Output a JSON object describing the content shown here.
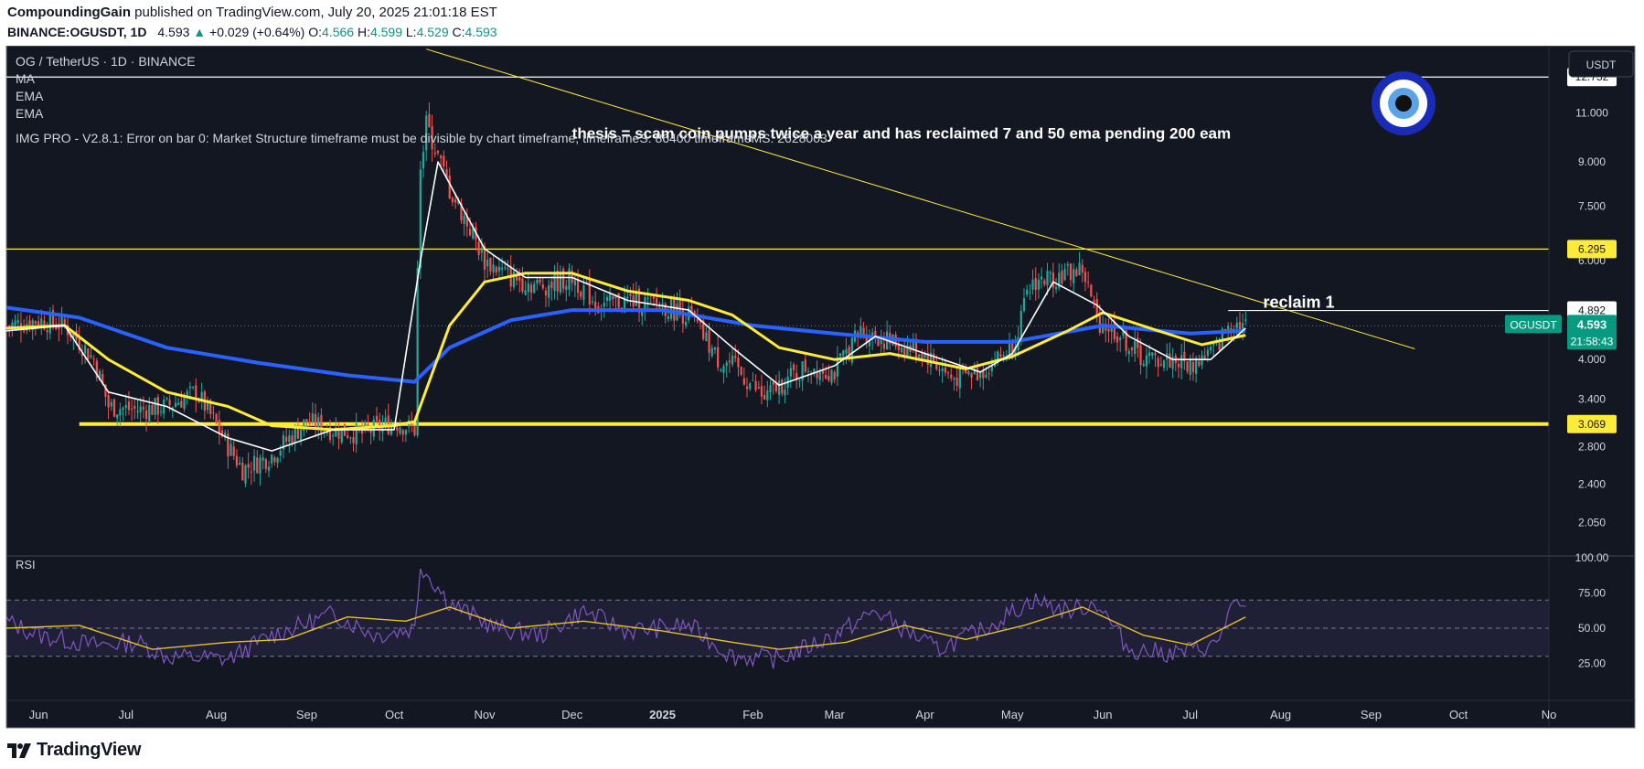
{
  "header": {
    "author": "CompoundingGain",
    "published_text": "published on TradingView.com, July 20, 2025 21:01:18 EST",
    "symbol": "BINANCE:OGUSDT, 1D",
    "last": "4.593",
    "change_arrow": "▲",
    "change": "+0.029 (+0.64%)",
    "o_label": "O:",
    "o": "4.566",
    "h_label": "H:",
    "h": "4.599",
    "l_label": "L:",
    "l": "4.529",
    "c_label": "C:",
    "c": "4.593"
  },
  "footer": {
    "brand": "TradingView"
  },
  "colors": {
    "background": "#131722",
    "candle_up": "#26a69a",
    "candle_down": "#ef5350",
    "ema_fast": "#ffffff",
    "ema_mid": "#ffeb3b",
    "ema_slow": "#2962ff",
    "support": "#ffeb3b",
    "rsi_line": "#7e57c2",
    "rsi_ma": "#e6c125",
    "last_price": "#089981"
  },
  "chart_data": {
    "type": "candlestick",
    "title": "OG / TetherUS · 1D · BINANCE",
    "currency_button": "USDT",
    "indicators": [
      "MA",
      "EMA",
      "EMA"
    ],
    "error_text": "IMG PRO - V2.8.1: Error on bar 0: Market Structure timeframe must be divisible by chart timeframe, timeframeS: 86400 timeframeMS: 2628003",
    "annotations": [
      {
        "text": "thesis = scam coin pumps twice a year and has reclaimed 7 and 50 ema pending 200 eam",
        "date": "2024-12-01",
        "price": 9.9
      },
      {
        "text": "reclaim 1",
        "date": "2025-07-26",
        "price": 4.95
      }
    ],
    "y_scale": "log",
    "y_range": [
      1.8,
      14.5
    ],
    "y_ticks": [
      "11.000",
      "9.000",
      "7.500",
      "6.000",
      "4.000",
      "3.400",
      "2.800",
      "2.400",
      "2.050"
    ],
    "y_tick_values": [
      11.0,
      9.0,
      7.5,
      6.0,
      4.0,
      3.4,
      2.8,
      2.4,
      2.05
    ],
    "x_range": [
      "2024-05-21",
      "2025-11-01"
    ],
    "x_ticks": [
      {
        "label": "Jun",
        "date": "2024-06-01"
      },
      {
        "label": "Jul",
        "date": "2024-07-01"
      },
      {
        "label": "Aug",
        "date": "2024-08-01"
      },
      {
        "label": "Sep",
        "date": "2024-09-01"
      },
      {
        "label": "Oct",
        "date": "2024-10-01"
      },
      {
        "label": "Nov",
        "date": "2024-11-01"
      },
      {
        "label": "Dec",
        "date": "2024-12-01"
      },
      {
        "label": "2025",
        "date": "2025-01-01",
        "bold": true
      },
      {
        "label": "Feb",
        "date": "2025-02-01"
      },
      {
        "label": "Mar",
        "date": "2025-03-01"
      },
      {
        "label": "Apr",
        "date": "2025-04-01"
      },
      {
        "label": "May",
        "date": "2025-05-01"
      },
      {
        "label": "Jun",
        "date": "2025-06-01"
      },
      {
        "label": "Jul",
        "date": "2025-07-01"
      },
      {
        "label": "Aug",
        "date": "2025-08-01"
      },
      {
        "label": "Sep",
        "date": "2025-09-01"
      },
      {
        "label": "Oct",
        "date": "2025-10-01"
      },
      {
        "label": "No",
        "date": "2025-11-01"
      }
    ],
    "price_labels": [
      {
        "value": "12.752",
        "price": 12.752,
        "style": "white"
      },
      {
        "value": "6.295",
        "price": 6.295,
        "style": "yellow"
      },
      {
        "value": "4.892",
        "price": 4.892,
        "style": "white"
      },
      {
        "value": "3.069",
        "price": 3.069,
        "style": "yellow"
      }
    ],
    "last_price": {
      "symbol": "OGUSDT",
      "value": "4.593",
      "price": 4.593,
      "countdown": "21:58:43"
    },
    "horizontal_lines": [
      {
        "price": 12.752,
        "color": "#ffffff",
        "from": "2024-05-21"
      },
      {
        "price": 6.295,
        "color": "#ffeb3b",
        "from": "2024-05-21"
      },
      {
        "price": 4.892,
        "color": "#ffffff",
        "from": "2025-07-14"
      },
      {
        "price": 3.069,
        "color": "#ffeb3b",
        "from": "2024-06-15",
        "thick": true
      }
    ],
    "trendline": {
      "from": {
        "date": "2024-10-12",
        "price": 14.3
      },
      "to": {
        "date": "2025-09-16",
        "price": 4.18
      }
    },
    "price_series": {
      "dates": [
        "2024-05-21",
        "2024-06-01",
        "2024-06-10",
        "2024-06-20",
        "2024-06-25",
        "2024-07-05",
        "2024-07-15",
        "2024-07-25",
        "2024-08-05",
        "2024-08-10",
        "2024-08-20",
        "2024-09-01",
        "2024-09-10",
        "2024-09-20",
        "2024-10-01",
        "2024-10-08",
        "2024-10-10",
        "2024-10-12",
        "2024-10-15",
        "2024-10-20",
        "2024-11-01",
        "2024-11-10",
        "2024-11-20",
        "2024-12-01",
        "2024-12-10",
        "2024-12-20",
        "2025-01-01",
        "2025-01-10",
        "2025-01-20",
        "2025-01-25",
        "2025-02-05",
        "2025-02-10",
        "2025-02-20",
        "2025-03-01",
        "2025-03-10",
        "2025-03-20",
        "2025-04-01",
        "2025-04-10",
        "2025-04-20",
        "2025-05-01",
        "2025-05-08",
        "2025-05-15",
        "2025-05-25",
        "2025-05-30",
        "2025-06-05",
        "2025-06-15",
        "2025-06-25",
        "2025-07-01",
        "2025-07-10",
        "2025-07-15",
        "2025-07-20"
      ],
      "close": [
        4.6,
        4.7,
        4.6,
        4.0,
        3.3,
        3.25,
        3.3,
        3.5,
        2.8,
        2.55,
        2.7,
        3.1,
        3.0,
        2.95,
        3.1,
        3.0,
        8.5,
        10.5,
        9.5,
        8.0,
        6.0,
        5.6,
        5.4,
        5.6,
        5.0,
        5.1,
        5.0,
        4.8,
        4.0,
        3.9,
        3.4,
        3.6,
        3.9,
        3.8,
        4.5,
        4.3,
        4.1,
        3.7,
        3.8,
        4.2,
        5.5,
        5.6,
        5.8,
        4.7,
        4.5,
        4.0,
        4.0,
        3.9,
        4.2,
        4.7,
        4.593
      ]
    },
    "ema_fast": {
      "dates": [
        "2024-05-21",
        "2024-06-10",
        "2024-06-25",
        "2024-07-15",
        "2024-08-05",
        "2024-08-20",
        "2024-09-10",
        "2024-10-01",
        "2024-10-10",
        "2024-10-16",
        "2024-11-01",
        "2024-11-15",
        "2024-12-01",
        "2024-12-20",
        "2025-01-10",
        "2025-01-25",
        "2025-02-10",
        "2025-03-01",
        "2025-03-15",
        "2025-04-01",
        "2025-04-20",
        "2025-05-01",
        "2025-05-15",
        "2025-05-30",
        "2025-06-10",
        "2025-06-25",
        "2025-07-08",
        "2025-07-20"
      ],
      "values": [
        4.5,
        4.6,
        3.5,
        3.3,
        2.9,
        2.75,
        3.0,
        3.0,
        6.0,
        9.0,
        6.3,
        5.6,
        5.6,
        5.1,
        4.9,
        4.2,
        3.6,
        3.9,
        4.4,
        4.1,
        3.8,
        4.1,
        5.5,
        5.0,
        4.4,
        4.0,
        4.0,
        4.55
      ]
    },
    "ema_mid": {
      "dates": [
        "2024-05-21",
        "2024-06-10",
        "2024-06-25",
        "2024-07-15",
        "2024-08-05",
        "2024-08-20",
        "2024-09-10",
        "2024-10-01",
        "2024-10-08",
        "2024-10-20",
        "2024-11-01",
        "2024-11-15",
        "2024-12-01",
        "2024-12-20",
        "2025-01-10",
        "2025-01-25",
        "2025-02-10",
        "2025-03-01",
        "2025-03-20",
        "2025-04-15",
        "2025-05-01",
        "2025-05-20",
        "2025-06-01",
        "2025-06-20",
        "2025-07-05",
        "2025-07-20"
      ],
      "values": [
        4.55,
        4.6,
        4.0,
        3.5,
        3.3,
        3.05,
        3.0,
        3.05,
        3.1,
        4.6,
        5.5,
        5.7,
        5.7,
        5.3,
        5.1,
        4.8,
        4.2,
        4.0,
        4.1,
        3.85,
        4.05,
        4.5,
        4.85,
        4.5,
        4.25,
        4.42
      ]
    },
    "ema_slow": {
      "dates": [
        "2024-05-21",
        "2024-06-15",
        "2024-07-15",
        "2024-08-15",
        "2024-09-15",
        "2024-10-08",
        "2024-10-20",
        "2024-11-10",
        "2024-12-01",
        "2025-01-01",
        "2025-02-01",
        "2025-03-01",
        "2025-04-01",
        "2025-05-01",
        "2025-06-01",
        "2025-07-01",
        "2025-07-20"
      ],
      "values": [
        4.95,
        4.75,
        4.2,
        3.95,
        3.75,
        3.65,
        4.2,
        4.7,
        4.9,
        4.9,
        4.6,
        4.45,
        4.3,
        4.3,
        4.6,
        4.45,
        4.5
      ]
    },
    "rsi": {
      "label": "RSI",
      "range": [
        0,
        100
      ],
      "ticks": [
        "100.00",
        "75.00",
        "50.00",
        "25.00"
      ],
      "tick_values": [
        100,
        75,
        50,
        25
      ],
      "band": [
        30,
        70
      ],
      "dates": [
        "2024-05-21",
        "2024-06-01",
        "2024-06-20",
        "2024-07-05",
        "2024-07-15",
        "2024-08-05",
        "2024-08-20",
        "2024-09-10",
        "2024-09-25",
        "2024-10-08",
        "2024-10-10",
        "2024-10-20",
        "2024-11-05",
        "2024-11-20",
        "2024-12-05",
        "2024-12-20",
        "2025-01-10",
        "2025-01-25",
        "2025-02-10",
        "2025-03-01",
        "2025-03-15",
        "2025-04-05",
        "2025-04-20",
        "2025-05-08",
        "2025-05-20",
        "2025-05-30",
        "2025-06-10",
        "2025-06-25",
        "2025-07-10",
        "2025-07-15",
        "2025-07-20"
      ],
      "values": [
        55,
        45,
        38,
        40,
        30,
        28,
        45,
        60,
        45,
        50,
        95,
        68,
        50,
        45,
        62,
        48,
        52,
        30,
        28,
        45,
        62,
        35,
        48,
        70,
        62,
        68,
        35,
        32,
        38,
        65,
        63
      ],
      "ma_dates": [
        "2024-05-21",
        "2024-06-15",
        "2024-07-10",
        "2024-08-05",
        "2024-08-25",
        "2024-09-15",
        "2024-10-05",
        "2024-10-20",
        "2024-11-10",
        "2024-12-05",
        "2025-01-01",
        "2025-01-25",
        "2025-02-10",
        "2025-03-05",
        "2025-03-25",
        "2025-04-15",
        "2025-05-05",
        "2025-05-25",
        "2025-06-15",
        "2025-07-01",
        "2025-07-20"
      ],
      "ma_values": [
        50,
        52,
        35,
        40,
        42,
        58,
        55,
        65,
        50,
        55,
        48,
        40,
        35,
        40,
        52,
        42,
        52,
        65,
        45,
        38,
        58
      ]
    }
  }
}
